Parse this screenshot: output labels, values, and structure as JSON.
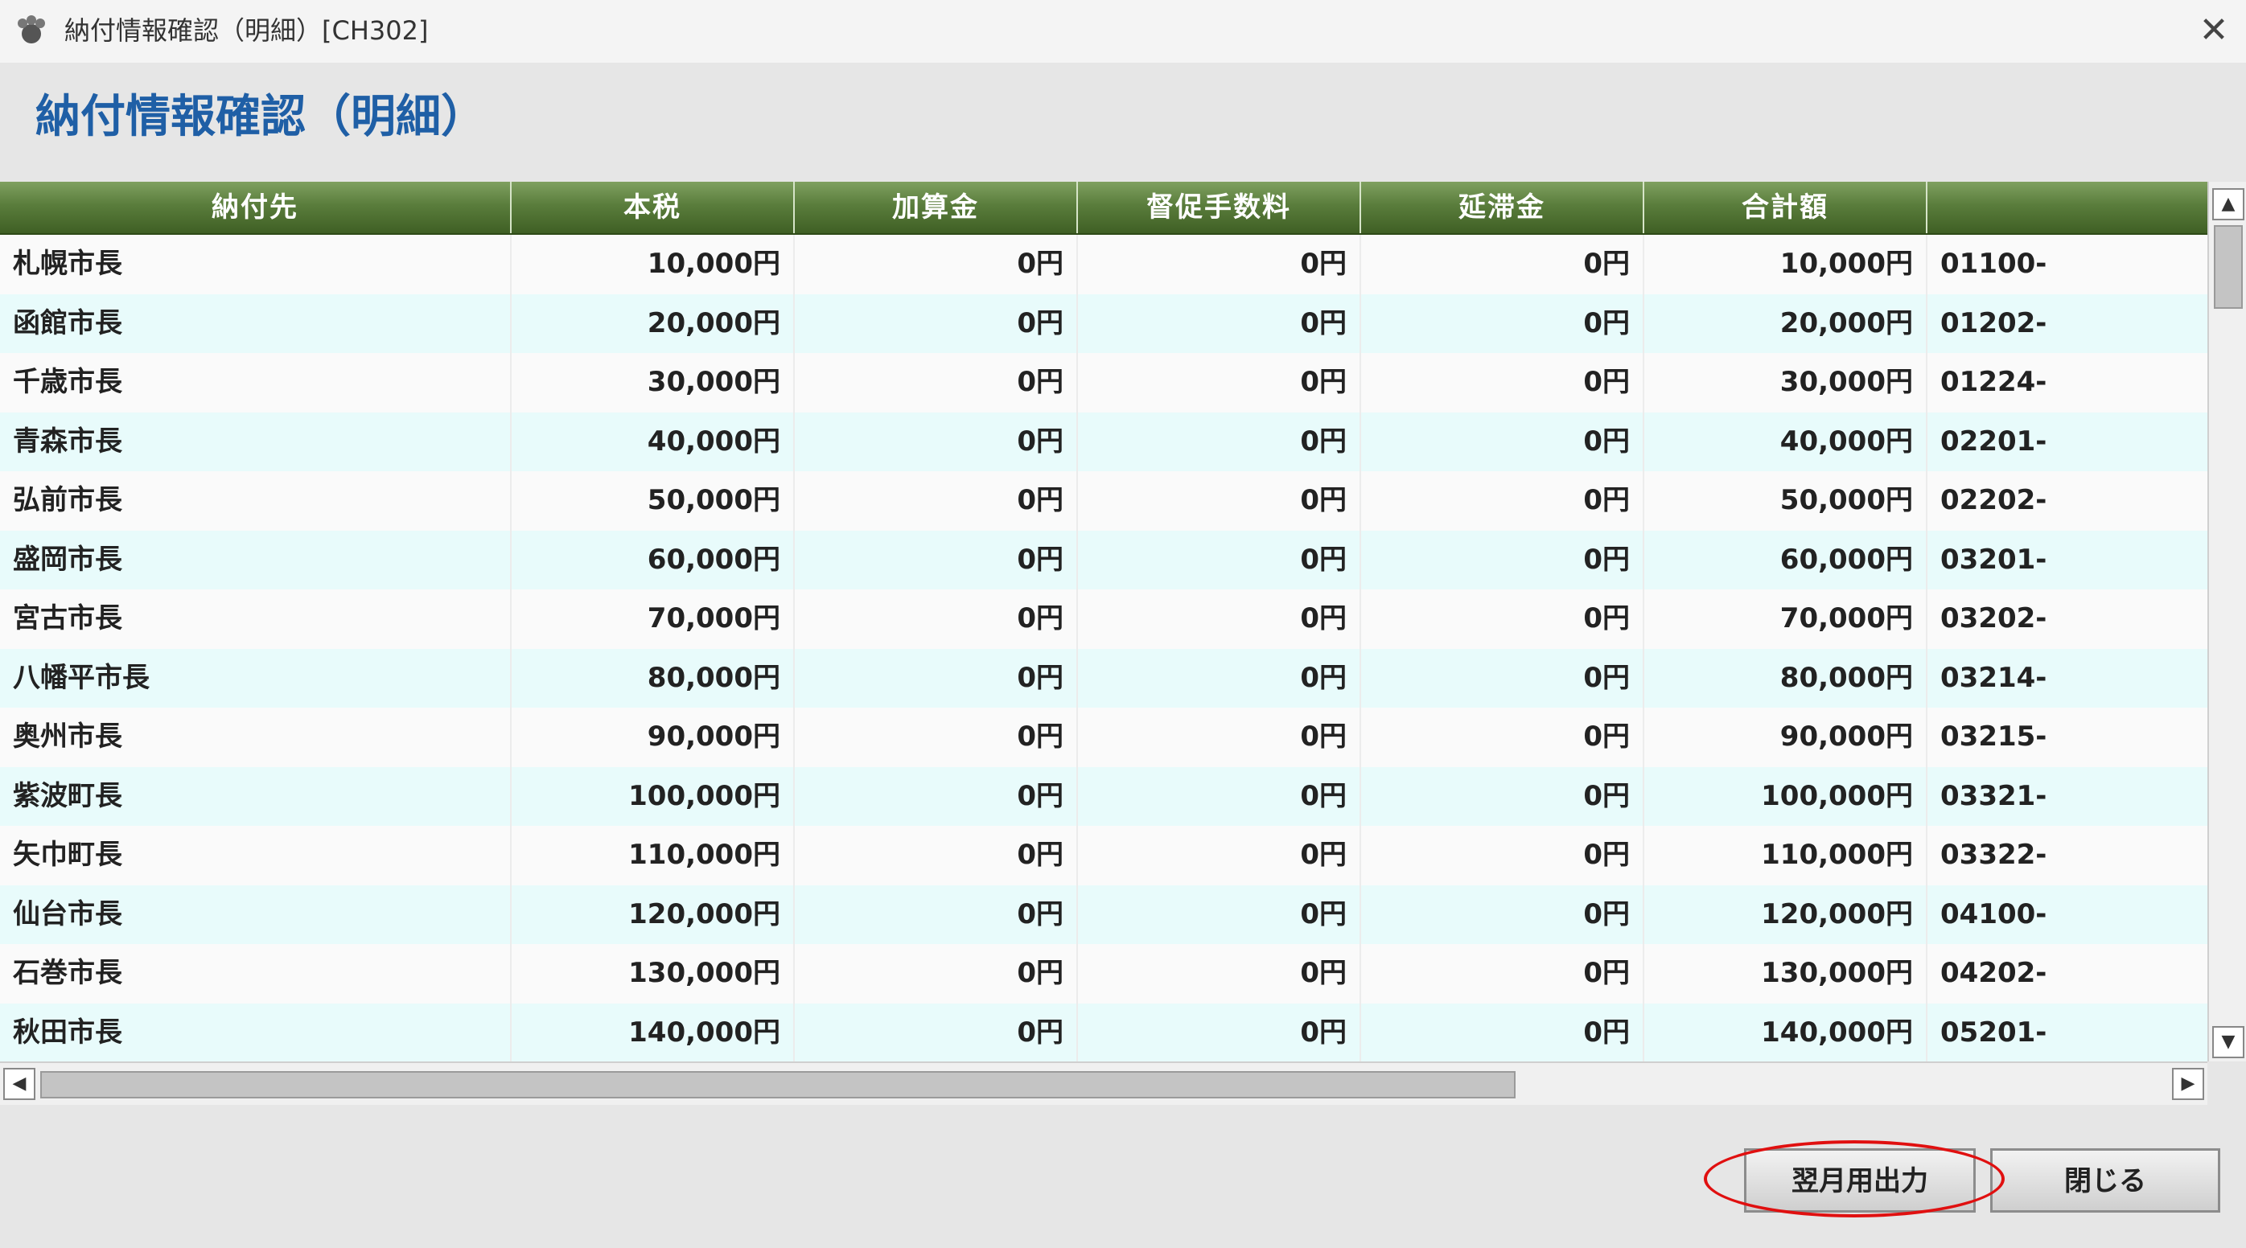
{
  "window": {
    "title": "納付情報確認（明細）[CH302]"
  },
  "page": {
    "title": "納付情報確認（明細）"
  },
  "table": {
    "columns": [
      "納付先",
      "本税",
      "加算金",
      "督促手数料",
      "延滞金",
      "合計額",
      ""
    ],
    "rows": [
      [
        "札幌市長",
        "10,000円",
        "0円",
        "0円",
        "0円",
        "10,000円",
        "01100-"
      ],
      [
        "函館市長",
        "20,000円",
        "0円",
        "0円",
        "0円",
        "20,000円",
        "01202-"
      ],
      [
        "千歳市長",
        "30,000円",
        "0円",
        "0円",
        "0円",
        "30,000円",
        "01224-"
      ],
      [
        "青森市長",
        "40,000円",
        "0円",
        "0円",
        "0円",
        "40,000円",
        "02201-"
      ],
      [
        "弘前市長",
        "50,000円",
        "0円",
        "0円",
        "0円",
        "50,000円",
        "02202-"
      ],
      [
        "盛岡市長",
        "60,000円",
        "0円",
        "0円",
        "0円",
        "60,000円",
        "03201-"
      ],
      [
        "宮古市長",
        "70,000円",
        "0円",
        "0円",
        "0円",
        "70,000円",
        "03202-"
      ],
      [
        "八幡平市長",
        "80,000円",
        "0円",
        "0円",
        "0円",
        "80,000円",
        "03214-"
      ],
      [
        "奥州市長",
        "90,000円",
        "0円",
        "0円",
        "0円",
        "90,000円",
        "03215-"
      ],
      [
        "紫波町長",
        "100,000円",
        "0円",
        "0円",
        "0円",
        "100,000円",
        "03321-"
      ],
      [
        "矢巾町長",
        "110,000円",
        "0円",
        "0円",
        "0円",
        "110,000円",
        "03322-"
      ],
      [
        "仙台市長",
        "120,000円",
        "0円",
        "0円",
        "0円",
        "120,000円",
        "04100-"
      ],
      [
        "石巻市長",
        "130,000円",
        "0円",
        "0円",
        "0円",
        "130,000円",
        "04202-"
      ],
      [
        "秋田市長",
        "140,000円",
        "0円",
        "0円",
        "0円",
        "140,000円",
        "05201-"
      ]
    ]
  },
  "buttons": {
    "next_month_output": "翌月用出力",
    "close": "閉じる"
  },
  "icons": {
    "app": "app-icon",
    "close": "close-icon"
  },
  "colors": {
    "header_green": "#5a7d3c",
    "title_blue": "#1f5fa6",
    "highlight_red": "#e01010",
    "row_alt": "#e8fbfb"
  }
}
